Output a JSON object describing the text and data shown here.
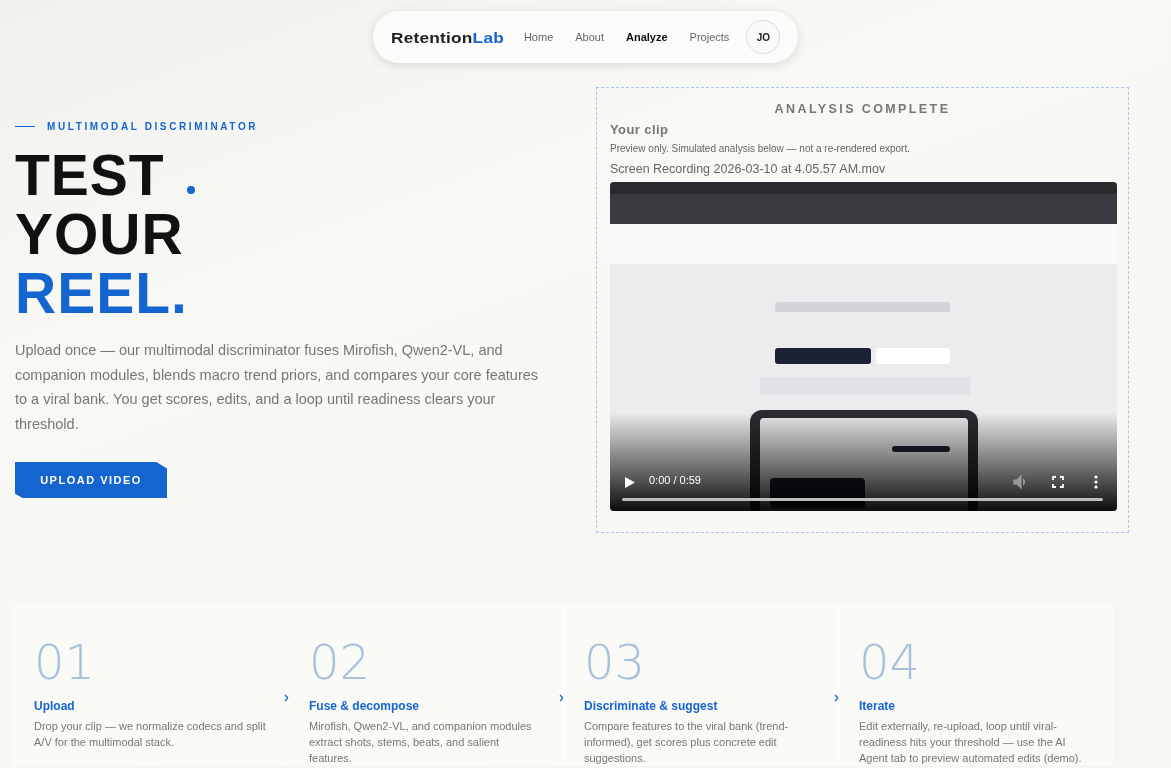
{
  "nav": {
    "logo": {
      "main": "Retention",
      "accent": "Lab"
    },
    "links": [
      {
        "label": "Home",
        "selected": false
      },
      {
        "label": "About",
        "selected": false
      },
      {
        "label": "Analyze",
        "selected": true
      },
      {
        "label": "Projects",
        "selected": false
      }
    ],
    "avatar": "JO"
  },
  "hero": {
    "eyebrow": "MULTIMODAL DISCRIMINATOR",
    "headline": [
      {
        "text": "TEST",
        "highlighted": false
      },
      {
        "text": "YOUR",
        "highlighted": false
      },
      {
        "text": "REEL.",
        "highlighted": true
      }
    ],
    "description": "Upload once — our multimodal discriminator fuses Mirofish, Qwen2-VL, and companion modules, blends macro trend priors, and compares your core features to a viral bank. You get scores, edits, and a loop until readiness clears your threshold.",
    "button": "UPLOAD VIDEO"
  },
  "analysis": {
    "status": "ANALYSIS COMPLETE",
    "title": "Your clip",
    "note": "Preview only. Simulated analysis below — not a re-rendered export.",
    "filename": "Screen Recording 2026-03-10 at 4.05.57 AM.mov",
    "video": {
      "kind": "picture",
      "time": "0:00 / 0:59",
      "level": 0
    }
  },
  "steps": [
    {
      "number": "01",
      "title": "Upload",
      "description": "Drop your clip — we normalize codecs and split A/V for the multimodal stack."
    },
    {
      "number": "02",
      "title": "Fuse & decompose",
      "description": "Mirofish, Qwen2-VL, and companion modules extract shots, stems, beats, and salient features."
    },
    {
      "number": "03",
      "title": "Discriminate & suggest",
      "description": "Compare features to the viral bank (trend-informed), get scores plus concrete edit suggestions."
    },
    {
      "number": "04",
      "title": "Iterate",
      "description": "Edit externally, re-upload, loop until viral-readiness hits your threshold — use the AI Agent tab to preview automated edits (demo)."
    }
  ]
}
